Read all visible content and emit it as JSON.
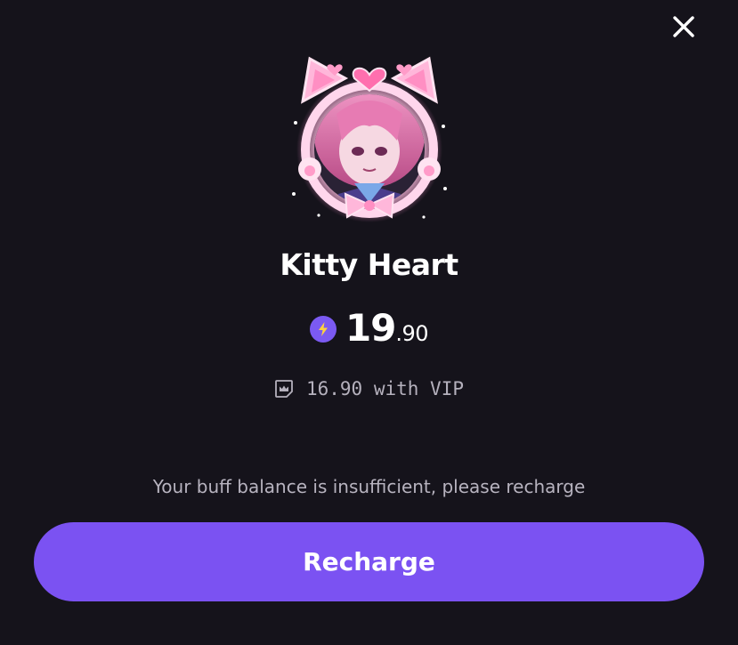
{
  "close": {
    "icon": "close-icon"
  },
  "item": {
    "name": "Kitty Heart",
    "avatar_icon": "kitty-heart-avatar-frame"
  },
  "price": {
    "coin_icon": "lightning-coin-icon",
    "integer": "19",
    "decimal": ".90"
  },
  "vip": {
    "icon": "vip-crown-icon",
    "text": "16.90 with VIP"
  },
  "message": "Your buff balance is insufficient, please recharge",
  "recharge_button": "Recharge",
  "colors": {
    "background": "#15131b",
    "accent": "#7b52f2",
    "muted_text": "#b7b3bf"
  }
}
